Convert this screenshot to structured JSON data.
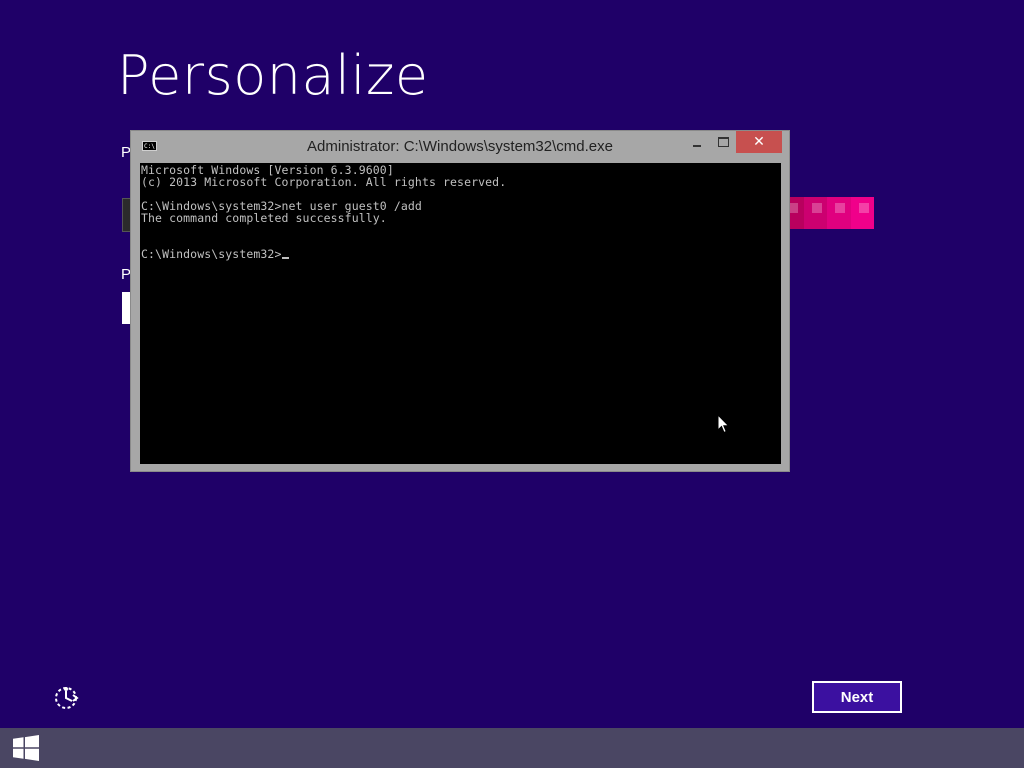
{
  "oobe": {
    "title": "Personalize",
    "hidden_label_1": "P",
    "hidden_label_2": "P",
    "next_label": "Next"
  },
  "cmd": {
    "title": "Administrator: C:\\Windows\\system32\\cmd.exe",
    "icon_text": "C:\\",
    "lines": [
      "Microsoft Windows [Version 6.3.9600]",
      "(c) 2013 Microsoft Corporation. All rights reserved.",
      "",
      "C:\\Windows\\system32>net user guest0 /add",
      "The command completed successfully.",
      "",
      "",
      "C:\\Windows\\system32>"
    ],
    "close_glyph": "✕"
  },
  "icons": {
    "app": "cmd-icon",
    "minimize": "minimize-icon",
    "maximize": "maximize-icon",
    "close": "close-icon",
    "ease_of_access": "ease-of-access-icon",
    "start": "windows-logo-icon",
    "pointer": "mouse-pointer-icon"
  },
  "colors": {
    "background": "#1f0068",
    "taskbar": "#4a4663",
    "close_button": "#c7504f",
    "console_bg": "#000000",
    "console_text": "#c0c0c0"
  }
}
